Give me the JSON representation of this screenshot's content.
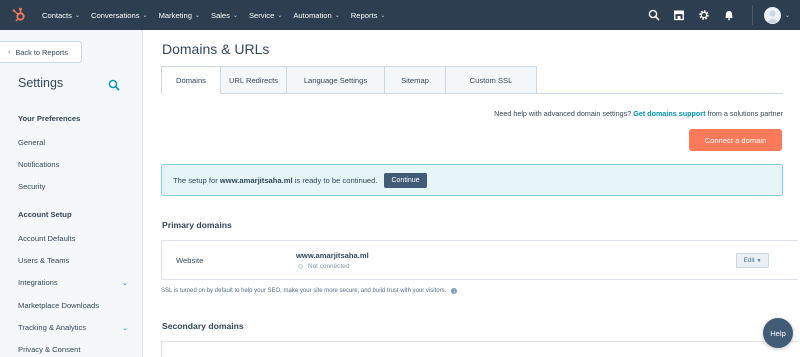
{
  "colors": {
    "nav_bg": "#2d3e50",
    "accent": "#ff7a59",
    "link": "#0091ae",
    "alert_bg": "#e5f5f8"
  },
  "topnav": {
    "logo_icon": "hubspot-sprocket-icon",
    "menu": [
      {
        "label": "Contacts"
      },
      {
        "label": "Conversations"
      },
      {
        "label": "Marketing"
      },
      {
        "label": "Sales"
      },
      {
        "label": "Service"
      },
      {
        "label": "Automation"
      },
      {
        "label": "Reports"
      }
    ],
    "icons": [
      "search-icon",
      "marketplace-icon",
      "settings-gear-icon",
      "notifications-bell-icon",
      "user-avatar"
    ]
  },
  "sidebar": {
    "back_label": "Back to Reports",
    "title": "Settings",
    "sections": [
      {
        "heading": "Your Preferences",
        "items": [
          {
            "label": "General"
          },
          {
            "label": "Notifications"
          },
          {
            "label": "Security"
          }
        ]
      },
      {
        "heading": "Account Setup",
        "items": [
          {
            "label": "Account Defaults"
          },
          {
            "label": "Users & Teams"
          },
          {
            "label": "Integrations",
            "expandable": true
          },
          {
            "label": "Marketplace Downloads"
          },
          {
            "label": "Tracking & Analytics",
            "expandable": true
          },
          {
            "label": "Privacy & Consent"
          }
        ]
      }
    ]
  },
  "main": {
    "title": "Domains & URLs",
    "tabs": [
      {
        "label": "Domains",
        "active": true
      },
      {
        "label": "URL Redirects"
      },
      {
        "label": "Language Settings"
      },
      {
        "label": "Sitemap"
      },
      {
        "label": "Custom SSL"
      }
    ],
    "help": {
      "prefix": "Need help with advanced domain settings?",
      "link": "Get domains support",
      "suffix": "from a solutions partner"
    },
    "connect_button": "Connect a domain",
    "alert": {
      "prefix": "The setup for",
      "domain": "www.amarjitsaha.ml",
      "suffix": "is ready to be continued.",
      "button": "Continue"
    },
    "primary": {
      "title": "Primary domains",
      "type": "Website",
      "domain": "www.amarjitsaha.ml",
      "status": "Not connected",
      "edit_label": "Edit"
    },
    "ssl_note": "SSL is turned on by default to help your SEO, make your site more secure, and build trust with your visitors.",
    "secondary_title": "Secondary domains"
  },
  "help_button": "Help"
}
